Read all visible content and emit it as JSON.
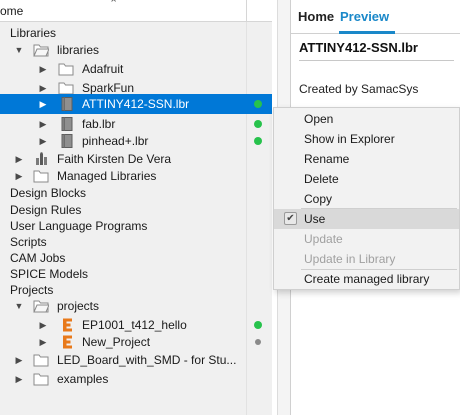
{
  "tree": {
    "header_label": "ome",
    "rows": [
      {
        "label": "Libraries"
      },
      {
        "label": "libraries"
      },
      {
        "label": "Adafruit"
      },
      {
        "label": "SparkFun"
      },
      {
        "label": "ATTINY412-SSN.lbr"
      },
      {
        "label": "fab.lbr"
      },
      {
        "label": "pinhead+.lbr"
      },
      {
        "label": "Faith Kirsten De Vera"
      },
      {
        "label": "Managed Libraries"
      },
      {
        "label": "Design Blocks"
      },
      {
        "label": "Design Rules"
      },
      {
        "label": "User Language Programs"
      },
      {
        "label": "Scripts"
      },
      {
        "label": "CAM Jobs"
      },
      {
        "label": "SPICE Models"
      },
      {
        "label": "Projects"
      },
      {
        "label": "projects"
      },
      {
        "label": "EP1001_t412_hello"
      },
      {
        "label": "New_Project"
      },
      {
        "label": "LED_Board_with_SMD - for Stu..."
      },
      {
        "label": "examples"
      }
    ]
  },
  "preview": {
    "tab_home": "Home",
    "tab_preview": "Preview",
    "title": "ATTINY412-SSN.lbr",
    "created_by": "Created by SamacSys"
  },
  "context_menu": {
    "items": [
      {
        "label": "Open"
      },
      {
        "label": "Show in Explorer"
      },
      {
        "label": "Rename"
      },
      {
        "label": "Delete"
      },
      {
        "label": "Copy"
      },
      {
        "label": "Use"
      },
      {
        "label": "Update"
      },
      {
        "label": "Update in Library"
      },
      {
        "label": "Create managed library"
      }
    ]
  },
  "colors": {
    "selection": "#0078d7",
    "accent": "#1a88c9",
    "status_green": "#27c24c",
    "eagle_project_orange": "#e8791a"
  }
}
